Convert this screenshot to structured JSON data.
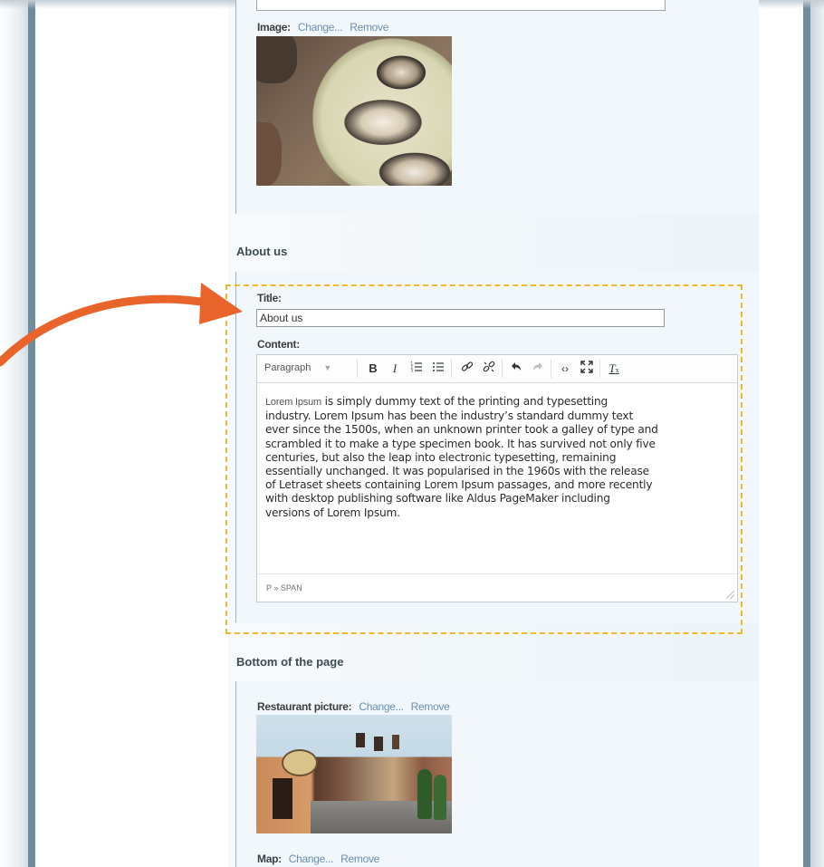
{
  "colors": {
    "accent_arrow": "#e8642a",
    "highlight_dash": "#f0b82a",
    "link": "#6c8fb3",
    "frame_bar": "#6f8c9e"
  },
  "image_field": {
    "label": "Image:",
    "change_link": "Change...",
    "remove_link": "Remove"
  },
  "about_section": {
    "heading": "About us",
    "title_label": "Title:",
    "title_value": "About us",
    "content_label": "Content:"
  },
  "editor": {
    "format_select": "Paragraph",
    "toolbar_icons": [
      "bold-icon",
      "italic-icon",
      "ordered-list-icon",
      "bullet-list-icon",
      "link-icon",
      "unlink-icon",
      "undo-icon",
      "redo-icon",
      "source-code-icon",
      "fullscreen-icon",
      "clear-formatting-icon"
    ],
    "body_lead": "Lorem Ipsum",
    "body_lines": [
      " is simply dummy text of the printing and typesetting",
      "industry. Lorem Ipsum has been the industry’s standard dummy text",
      "ever since the 1500s, when an unknown printer took a galley of type and",
      "scrambled it to make a type specimen book. It has survived not only five",
      "centuries, but also the leap into electronic typesetting, remaining",
      "essentially unchanged. It was popularised in the 1960s with the release",
      "of Letraset sheets containing Lorem Ipsum passages, and more recently",
      "with desktop publishing software like Aldus PageMaker including",
      "versions of Lorem Ipsum."
    ],
    "status_path": "P » SPAN"
  },
  "bottom_section": {
    "heading": "Bottom of the page",
    "restaurant_label": "Restaurant picture:",
    "restaurant_change": "Change...",
    "restaurant_remove": "Remove",
    "map_label": "Map:",
    "map_change": "Change...",
    "map_remove": "Remove"
  }
}
